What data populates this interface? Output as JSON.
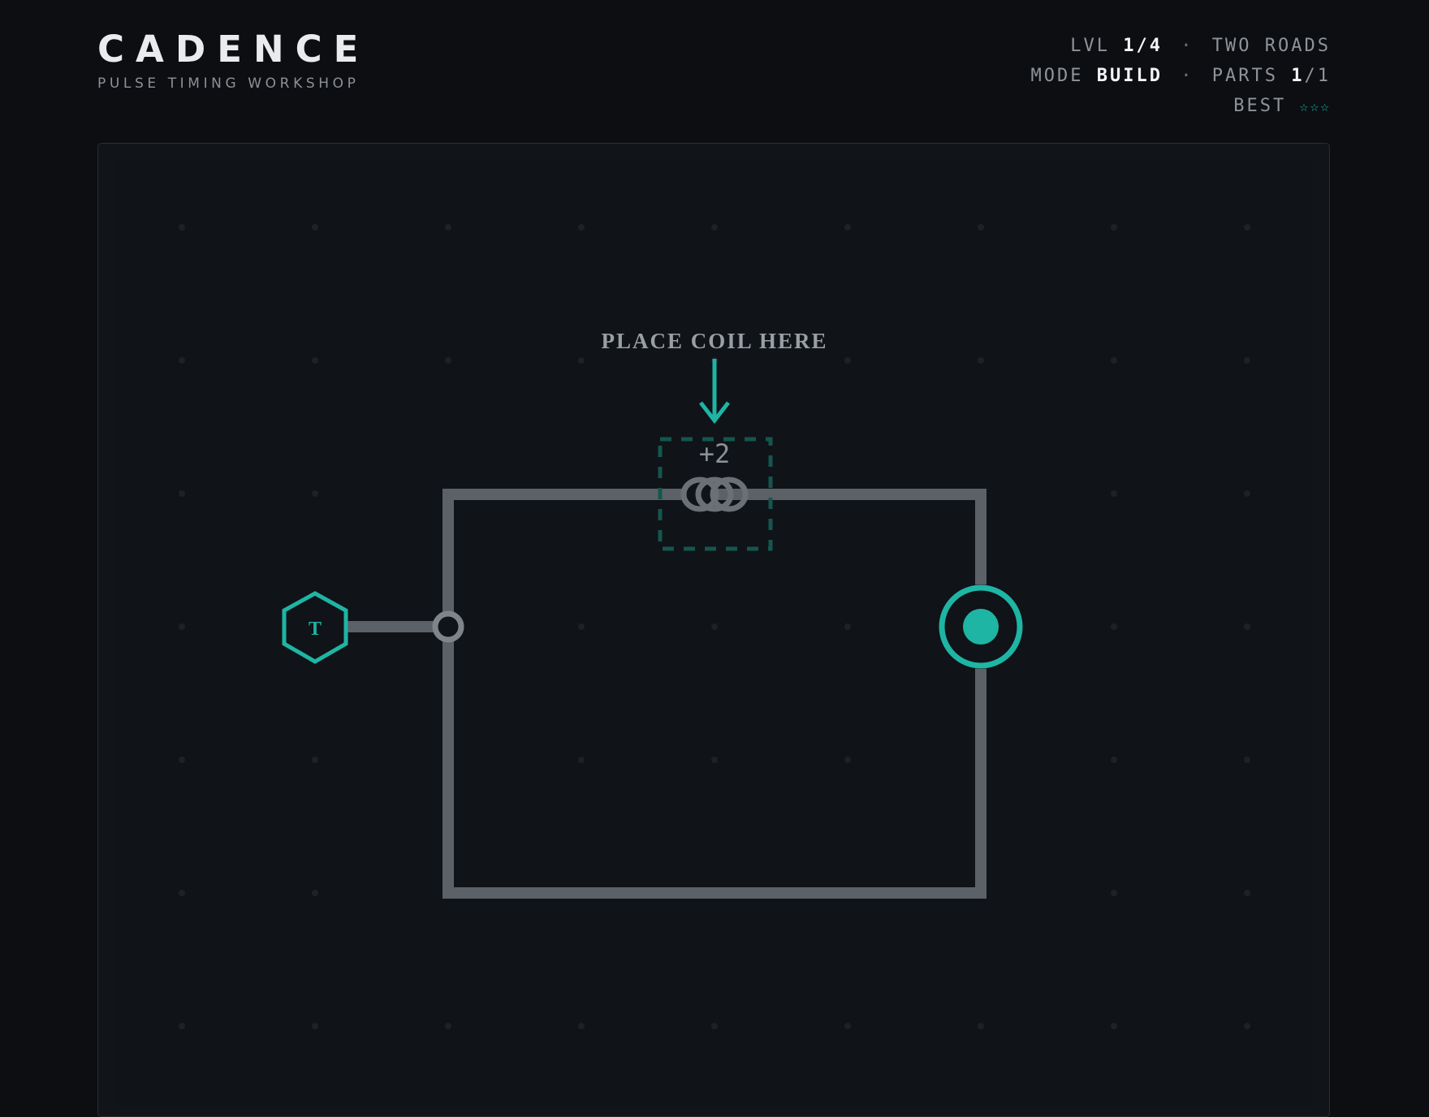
{
  "brand": {
    "title": "CADENCE",
    "subtitle": "PULSE TIMING WORKSHOP"
  },
  "status": {
    "level_label": "LVL",
    "level_value": "1/4",
    "level_name": "TWO ROADS",
    "mode_label": "MODE",
    "mode_value": "BUILD",
    "parts_label": "PARTS",
    "parts_used": "1",
    "parts_total": "/1",
    "best_label": "BEST",
    "best_stars": "☆☆☆",
    "separator": "·"
  },
  "board": {
    "hint_label": "PLACE COIL HERE",
    "coil_delay_label": "+2",
    "source_glyph": "T",
    "colors": {
      "accent": "#1eb5a4",
      "wire": "#5b6167",
      "slot_dash": "#15564f",
      "grid_dot": "#1e2227"
    },
    "icons": {
      "source": "hexagon-source-icon",
      "junction": "junction-node-icon",
      "coil": "coil-icon",
      "target": "target-receiver-icon",
      "hint_arrow": "arrow-down-icon"
    }
  }
}
